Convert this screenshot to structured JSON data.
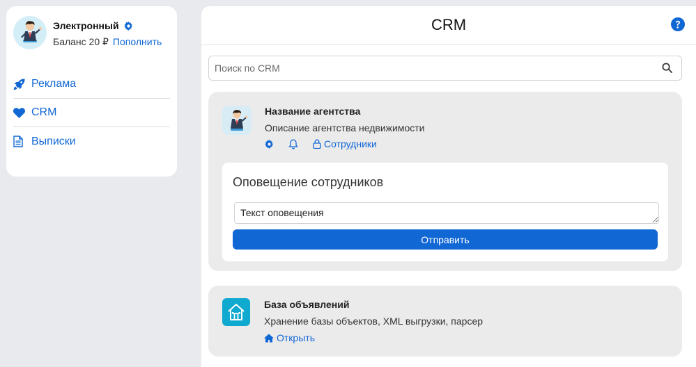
{
  "sidebar": {
    "profile_name": "Электронный",
    "balance_label": "Баланс 20 ₽",
    "topup_label": "Пополнить",
    "items": [
      {
        "label": "Реклама",
        "icon": "rocket-icon"
      },
      {
        "label": "CRM",
        "icon": "heart-icon"
      },
      {
        "label": "Выписки",
        "icon": "document-icon"
      }
    ]
  },
  "header": {
    "title": "CRM"
  },
  "search": {
    "placeholder": "Поиск по CRM"
  },
  "agency": {
    "title": "Название агентства",
    "description": "Описание агентства недвижимости",
    "employees_label": "Сотрудники"
  },
  "notify": {
    "heading": "Оповещение сотрудников",
    "textarea_value": "Текст оповещения",
    "send_label": "Отправить"
  },
  "ads_db": {
    "title": "База объявлений",
    "description": "Хранение базы объектов, XML выгрузки, парсер",
    "open_label": "Открыть"
  },
  "colors": {
    "accent": "#1167d4",
    "page_bg": "#e9eaed",
    "card_bg": "#ebebec",
    "db_icon_bg": "#10a9cf"
  }
}
